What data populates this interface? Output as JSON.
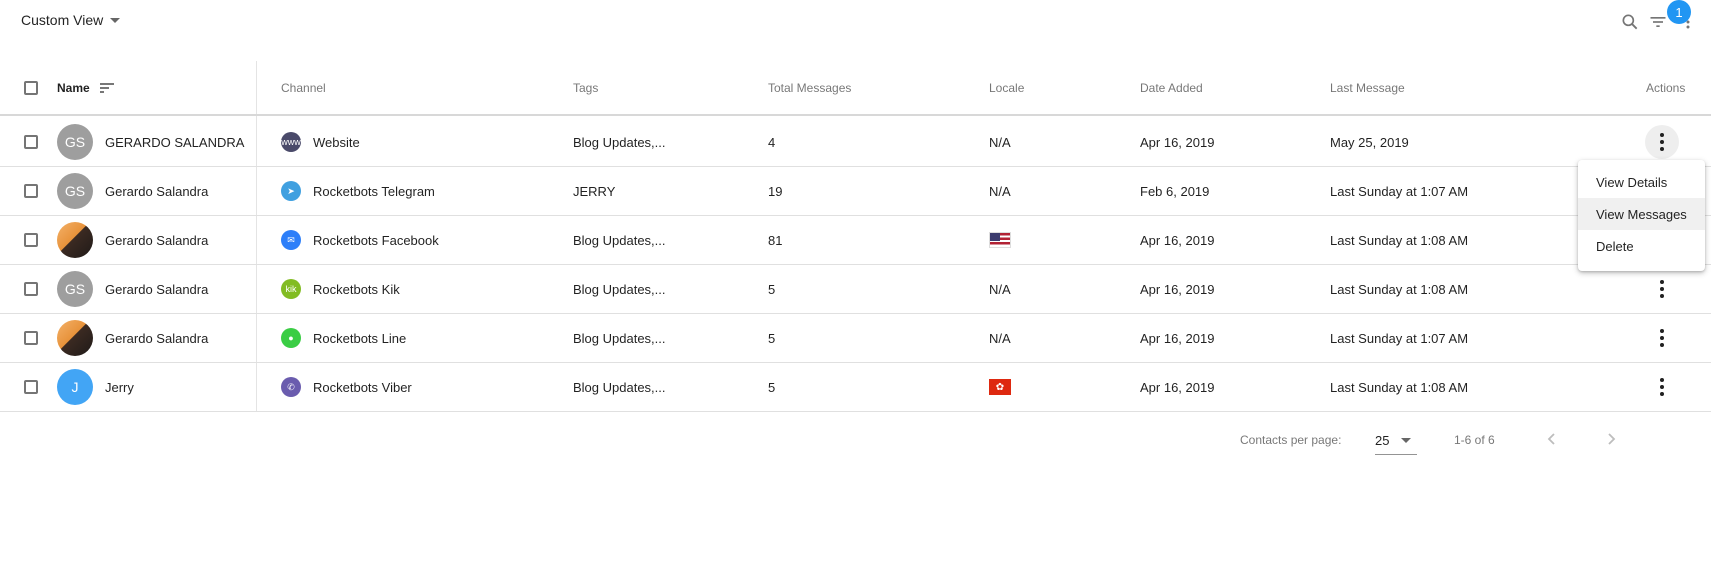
{
  "toolbar": {
    "view_label": "Custom View",
    "filter_badge": "1"
  },
  "table": {
    "headers": {
      "name": "Name",
      "channel": "Channel",
      "tags": "Tags",
      "total_messages": "Total Messages",
      "locale": "Locale",
      "date_added": "Date Added",
      "last_message": "Last Message",
      "actions": "Actions"
    },
    "rows": [
      {
        "initials": "GS",
        "avatar": "gray",
        "name": "GERARDO SALANDRA",
        "channel": "Website",
        "channel_icon": "website-icon",
        "channel_color": "#4a4a6a",
        "tags": "Blog Updates,...",
        "total_messages": "4",
        "locale": "N/A",
        "locale_flag": "",
        "date_added": "Apr 16, 2019",
        "last_message": "May 25, 2019"
      },
      {
        "initials": "GS",
        "avatar": "gray",
        "name": "Gerardo Salandra",
        "channel": "Rocketbots Telegram",
        "channel_icon": "telegram-icon",
        "channel_color": "#40a0e0",
        "tags": "JERRY",
        "total_messages": "19",
        "locale": "N/A",
        "locale_flag": "",
        "date_added": "Feb 6, 2019",
        "last_message": "Last Sunday at 1:07 AM"
      },
      {
        "initials": "",
        "avatar": "photo",
        "name": "Gerardo Salandra",
        "channel": "Rocketbots Facebook",
        "channel_icon": "messenger-icon",
        "channel_color": "#2d7ff9",
        "tags": "Blog Updates,...",
        "total_messages": "81",
        "locale": "",
        "locale_flag": "us-flag-icon",
        "date_added": "Apr 16, 2019",
        "last_message": "Last Sunday at 1:08 AM"
      },
      {
        "initials": "GS",
        "avatar": "gray",
        "name": "Gerardo Salandra",
        "channel": "Rocketbots Kik",
        "channel_icon": "kik-icon",
        "channel_color": "#82bc23",
        "tags": "Blog Updates,...",
        "total_messages": "5",
        "locale": "N/A",
        "locale_flag": "",
        "date_added": "Apr 16, 2019",
        "last_message": "Last Sunday at 1:08 AM"
      },
      {
        "initials": "",
        "avatar": "photo",
        "name": "Gerardo Salandra",
        "channel": "Rocketbots Line",
        "channel_icon": "line-icon",
        "channel_color": "#3acd44",
        "tags": "Blog Updates,...",
        "total_messages": "5",
        "locale": "N/A",
        "locale_flag": "",
        "date_added": "Apr 16, 2019",
        "last_message": "Last Sunday at 1:07 AM"
      },
      {
        "initials": "J",
        "avatar": "blue",
        "name": "Jerry",
        "channel": "Rocketbots Viber",
        "channel_icon": "viber-icon",
        "channel_color": "#6a5cae",
        "tags": "Blog Updates,...",
        "total_messages": "5",
        "locale": "",
        "locale_flag": "hk-flag-icon",
        "date_added": "Apr 16, 2019",
        "last_message": "Last Sunday at 1:08 AM"
      }
    ]
  },
  "pagination": {
    "label": "Contacts per page:",
    "per_page": "25",
    "range": "1-6 of 6"
  },
  "context_menu": {
    "items": [
      "View Details",
      "View Messages",
      "Delete"
    ],
    "highlighted_index": 1
  },
  "colors": {
    "accent": "#2196f3"
  }
}
